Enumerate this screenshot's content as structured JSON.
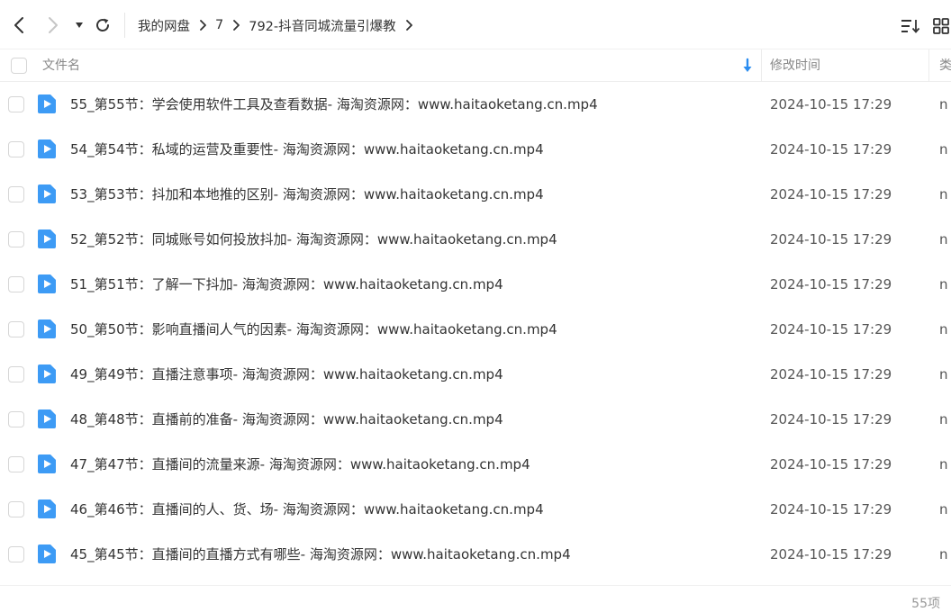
{
  "toolbar": {
    "back_icon": "chevron-left-icon",
    "forward_icon": "chevron-right-icon",
    "history_icon": "caret-down-icon",
    "refresh_icon": "refresh-icon",
    "sort_icon": "sort-list-icon",
    "view_icon": "grid-view-icon"
  },
  "breadcrumb": [
    {
      "label": "我的网盘"
    },
    {
      "label": "7"
    },
    {
      "label": "792-抖音同城流量引爆教"
    }
  ],
  "table": {
    "headers": {
      "name": "文件名",
      "modified": "修改时间",
      "type": "类"
    },
    "sort_arrow_color": "#2a8cf0"
  },
  "files": [
    {
      "name": "55_第55节：学会使用软件工具及查看数据- 海淘资源网：www.haitaoketang.cn.mp4",
      "modified": "2024-10-15 17:29",
      "type": "n"
    },
    {
      "name": "54_第54节：私域的运营及重要性- 海淘资源网：www.haitaoketang.cn.mp4",
      "modified": "2024-10-15 17:29",
      "type": "n"
    },
    {
      "name": "53_第53节：抖加和本地推的区别- 海淘资源网：www.haitaoketang.cn.mp4",
      "modified": "2024-10-15 17:29",
      "type": "n"
    },
    {
      "name": "52_第52节：同城账号如何投放抖加- 海淘资源网：www.haitaoketang.cn.mp4",
      "modified": "2024-10-15 17:29",
      "type": "n"
    },
    {
      "name": "51_第51节：了解一下抖加- 海淘资源网：www.haitaoketang.cn.mp4",
      "modified": "2024-10-15 17:29",
      "type": "n"
    },
    {
      "name": "50_第50节：影响直播间人气的因素- 海淘资源网：www.haitaoketang.cn.mp4",
      "modified": "2024-10-15 17:29",
      "type": "n"
    },
    {
      "name": "49_第49节：直播注意事项- 海淘资源网：www.haitaoketang.cn.mp4",
      "modified": "2024-10-15 17:29",
      "type": "n"
    },
    {
      "name": "48_第48节：直播前的准备- 海淘资源网：www.haitaoketang.cn.mp4",
      "modified": "2024-10-15 17:29",
      "type": "n"
    },
    {
      "name": "47_第47节：直播间的流量来源- 海淘资源网：www.haitaoketang.cn.mp4",
      "modified": "2024-10-15 17:29",
      "type": "n"
    },
    {
      "name": "46_第46节：直播间的人、货、场- 海淘资源网：www.haitaoketang.cn.mp4",
      "modified": "2024-10-15 17:29",
      "type": "n"
    },
    {
      "name": "45_第45节：直播间的直播方式有哪些- 海淘资源网：www.haitaoketang.cn.mp4",
      "modified": "2024-10-15 17:29",
      "type": "n"
    }
  ],
  "file_icon": {
    "name": "video-file-icon",
    "color": "#3d9bf5"
  },
  "footer": {
    "count": "55项"
  }
}
